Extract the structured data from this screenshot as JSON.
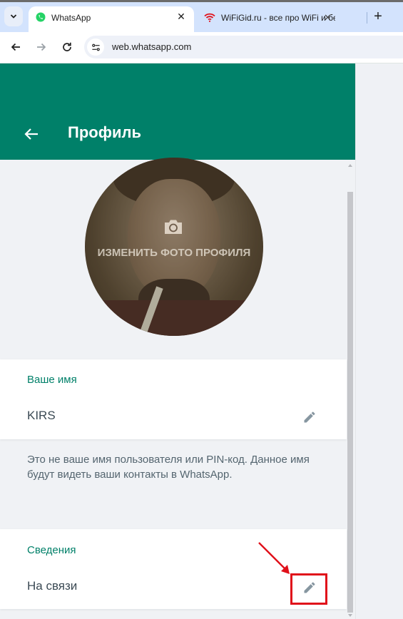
{
  "browser": {
    "tabs": [
      {
        "title": "WhatsApp",
        "active": true,
        "icon": "whatsapp-icon"
      },
      {
        "title": "WiFiGid.ru - все про WiFi и бес",
        "active": false,
        "icon": "wifi-icon"
      }
    ],
    "close_glyph": "✕",
    "new_tab_glyph": "+",
    "url": "web.whatsapp.com"
  },
  "header": {
    "title": "Профиль"
  },
  "avatar": {
    "overlay_text": "ИЗМЕНИТЬ ФОТО ПРОФИЛЯ"
  },
  "name_section": {
    "label": "Ваше имя",
    "value": "KIRS",
    "hint": "Это не ваше имя пользователя или PIN-код. Данное имя будут видеть ваши контакты в WhatsApp."
  },
  "about_section": {
    "label": "Сведения",
    "value": "На связи"
  },
  "colors": {
    "accent": "#008069",
    "annotation": "#e0101a"
  }
}
